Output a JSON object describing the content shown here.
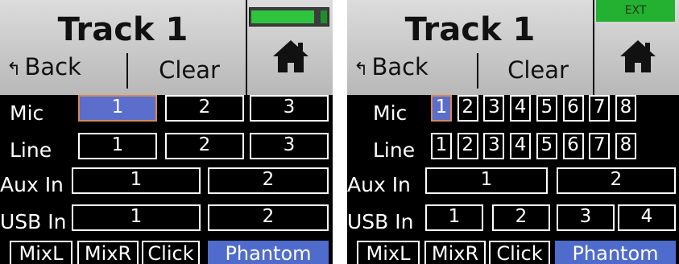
{
  "left": {
    "title": "Track 1",
    "back_label": "Back",
    "clear_label": "Clear",
    "rows": [
      {
        "label": "Mic",
        "cells": [
          "1",
          "2",
          "3"
        ]
      },
      {
        "label": "Line",
        "cells": [
          "1",
          "2",
          "3"
        ]
      },
      {
        "label": "Aux In",
        "cells": [
          "1",
          "2"
        ]
      },
      {
        "label": "USB In",
        "cells": [
          "1",
          "2"
        ]
      }
    ],
    "bottom": [
      "MixL",
      "MixR",
      "Click",
      "Phantom"
    ],
    "meter_level": 0.83
  },
  "right": {
    "title": "Track 1",
    "ext_label": "EXT",
    "back_label": "Back",
    "clear_label": "Clear",
    "rows": [
      {
        "label": "Mic",
        "cells": [
          "1",
          "2",
          "3",
          "4",
          "5",
          "6",
          "7",
          "8"
        ]
      },
      {
        "label": "Line",
        "cells": [
          "1",
          "2",
          "3",
          "4",
          "5",
          "6",
          "7",
          "8"
        ]
      },
      {
        "label": "Aux In",
        "cells": [
          "1",
          "2"
        ]
      },
      {
        "label": "USB In",
        "cells": [
          "1",
          "2",
          "3",
          "4"
        ]
      }
    ],
    "bottom": [
      "MixL",
      "MixR",
      "Click",
      "Phantom"
    ]
  },
  "colors": {
    "selected": "#5b6ecb",
    "selected_border": "#d58a5a",
    "phantom": "#4f6ccc",
    "meter_green": "#2fc43e",
    "ext_green": "#24b030"
  },
  "icons": [
    "back-arrow-icon",
    "home-icon"
  ]
}
